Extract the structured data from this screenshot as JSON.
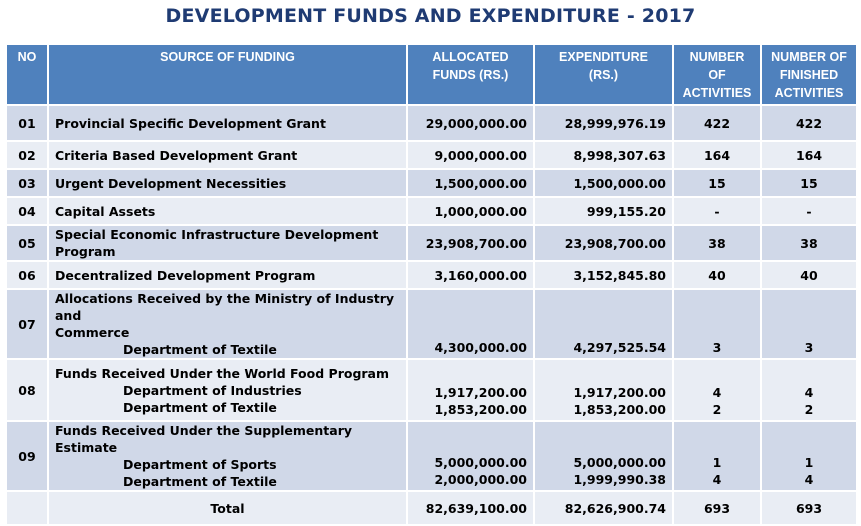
{
  "title": "DEVELOPMENT FUNDS AND EXPENDITURE - 2017",
  "headers": {
    "no": "NO",
    "source": "SOURCE OF FUNDING",
    "allocated_1": "ALLOCATED",
    "allocated_2": "FUNDS (RS.)",
    "expenditure_1": "EXPENDITURE",
    "expenditure_2": "(RS.)",
    "activities_1": "NUMBER",
    "activities_2": "OF",
    "activities_3": "ACTIVITIES",
    "finished_1": "NUMBER OF",
    "finished_2": "FINISHED",
    "finished_3": "ACTIVITIES"
  },
  "rows": [
    {
      "no": "01",
      "source": "Provincial Specific Development Grant",
      "allocated": "29,000,000.00",
      "expenditure": "28,999,976.19",
      "activities": "422",
      "finished": "422"
    },
    {
      "no": "02",
      "source": "Criteria Based Development Grant",
      "allocated": "9,000,000.00",
      "expenditure": "8,998,307.63",
      "activities": "164",
      "finished": "164"
    },
    {
      "no": "03",
      "source": "Urgent Development Necessities",
      "allocated": "1,500,000.00",
      "expenditure": "1,500,000.00",
      "activities": "15",
      "finished": "15"
    },
    {
      "no": "04",
      "source": "Capital Assets",
      "allocated": "1,000,000.00",
      "expenditure": "999,155.20",
      "activities": "-",
      "finished": "-"
    },
    {
      "no": "05",
      "source": "Special Economic Infrastructure  Development Program",
      "allocated": "23,908,700.00",
      "expenditure": "23,908,700.00",
      "activities": "38",
      "finished": "38"
    },
    {
      "no": "06",
      "source": "Decentralized Development Program",
      "allocated": "3,160,000.00",
      "expenditure": "3,152,845.80",
      "activities": "40",
      "finished": "40"
    },
    {
      "no": "07",
      "source_line1": "Allocations Received by the Ministry of Industry and",
      "source_line2": "Commerce",
      "sub1": "Department of Textile",
      "allocated1": "4,300,000.00",
      "expenditure1": "4,297,525.54",
      "activities1": "3",
      "finished1": "3"
    },
    {
      "no": "08",
      "source_line1": "Funds Received Under the World Food Program",
      "sub1": "Department of Industries",
      "sub2": "Department of Textile",
      "allocated1": "1,917,200.00",
      "allocated2": "1,853,200.00",
      "expenditure1": "1,917,200.00",
      "expenditure2": "1,853,200.00",
      "activities1": "4",
      "activities2": "2",
      "finished1": "4",
      "finished2": "2"
    },
    {
      "no": "09",
      "source_line1": "Funds Received Under the Supplementary Estimate",
      "sub1": "Department of  Sports",
      "sub2": "Department of Textile",
      "allocated1": "5,000,000.00",
      "allocated2": "2,000,000.00",
      "expenditure1": "5,000,000.00",
      "expenditure2": "1,999,990.38",
      "activities1": "1",
      "activities2": "4",
      "finished1": "1",
      "finished2": "4"
    }
  ],
  "total": {
    "label": "Total",
    "allocated": "82,639,100.00",
    "expenditure": "82,626,900.74",
    "activities": "693",
    "finished": "693"
  }
}
